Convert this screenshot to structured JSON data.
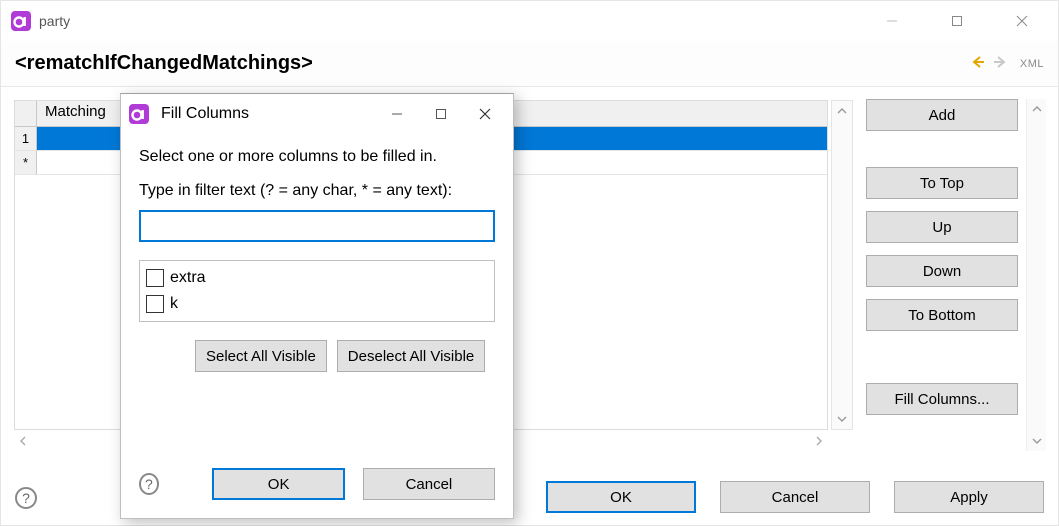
{
  "window": {
    "title": "party"
  },
  "header": {
    "tag_title": "<rematchIfChangedMatchings>",
    "xml_label": "XML"
  },
  "grid": {
    "columns": [
      "Matching"
    ],
    "row_headers": [
      "1",
      "*"
    ],
    "rows": [
      {
        "selected": true,
        "cells": [
          ""
        ]
      },
      {
        "selected": false,
        "cells": [
          ""
        ]
      }
    ]
  },
  "side_buttons": {
    "add": "Add",
    "to_top": "To Top",
    "up": "Up",
    "down": "Down",
    "to_bottom": "To Bottom",
    "fill_columns": "Fill Columns..."
  },
  "parent_buttons": {
    "ok": "OK",
    "cancel": "Cancel",
    "apply": "Apply"
  },
  "dialog": {
    "title": "Fill Columns",
    "message": "Select one or more columns to be filled in.",
    "filter_label": "Type in filter text (? = any char, * = any text):",
    "filter_value": "",
    "filter_placeholder": "",
    "options": [
      {
        "label": "extra",
        "checked": false
      },
      {
        "label": "k",
        "checked": false
      }
    ],
    "select_all": "Select All Visible",
    "deselect_all": "Deselect All Visible",
    "ok": "OK",
    "cancel": "Cancel"
  },
  "icons": {
    "app": "app-icon",
    "minimize": "minimize-icon",
    "maximize": "maximize-icon",
    "close": "close-icon",
    "nav_back": "nav-back-icon",
    "nav_forward": "nav-forward-icon",
    "help": "help-icon",
    "scroll_up": "chevron-up-icon",
    "scroll_down": "chevron-down-icon",
    "hscroll_left": "chevron-left-icon",
    "hscroll_right": "chevron-right-icon"
  },
  "colors": {
    "selected_row": "#0078d7",
    "button_bg": "#e1e1e1",
    "button_border": "#adadad"
  }
}
